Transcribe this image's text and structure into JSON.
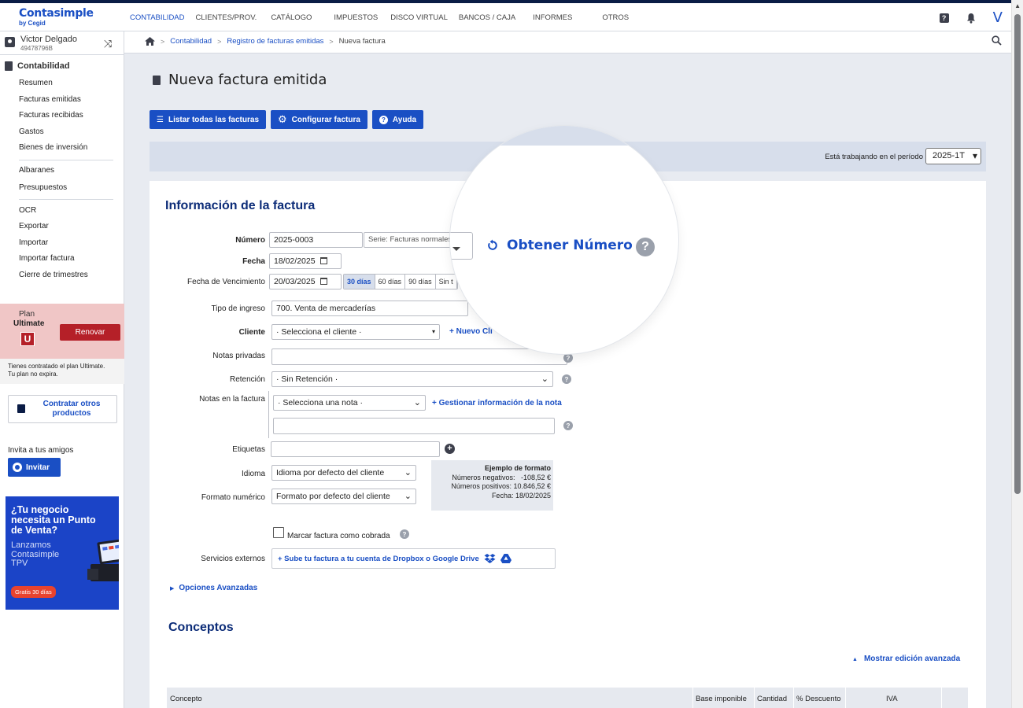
{
  "brand": {
    "name": "Contasimple",
    "sub": "by Cegid"
  },
  "topnav": [
    "CONTABILIDAD",
    "CLIENTES/PROV.",
    "CATÁLOGO",
    "IMPUESTOS",
    "DISCO VIRTUAL",
    "BANCOS / CAJA",
    "INFORMES",
    "OTROS"
  ],
  "topnav_active": "CONTABILIDAD",
  "top_icons": {
    "help": "?",
    "bell": "bell-icon",
    "user_initial": "V"
  },
  "user": {
    "name": "Victor Delgado",
    "id": "49478796B"
  },
  "sidebar": {
    "section": "Contabilidad",
    "group1": [
      "Resumen",
      "Facturas emitidas",
      "Facturas recibidas",
      "Gastos",
      "Bienes de inversión"
    ],
    "group2": [
      "Albaranes",
      "Presupuestos"
    ],
    "group3": [
      "OCR",
      "Exportar",
      "Importar",
      "Importar factura",
      "Cierre de trimestres"
    ]
  },
  "plan": {
    "label": "Plan",
    "name": "Ultimate",
    "badge": "U",
    "renew": "Renovar",
    "info_line1": "Tienes contratado el plan Ultimate.",
    "info_line2": "Tu plan no expira."
  },
  "contract": {
    "line1": "Contratar otros",
    "line2": "productos"
  },
  "invite": {
    "label": "Invita a tus amigos",
    "button": "Invitar"
  },
  "promo": {
    "title_lines": [
      "¿Tu negocio",
      "necesita un Punto",
      "de Venta?"
    ],
    "sub_lines": [
      "Lanzamos",
      "Contasimple",
      "TPV"
    ],
    "button": "Gratis 30 días"
  },
  "breadcrumb": {
    "items": [
      "Contabilidad",
      "Registro de facturas emitidas"
    ],
    "current": "Nueva factura"
  },
  "page": {
    "title": "Nueva factura emitida"
  },
  "buttons": {
    "list": "Listar todas las facturas",
    "config": "Configurar factura",
    "help": "Ayuda"
  },
  "period": {
    "label": "Está trabajando en el período",
    "value": "2025-1T"
  },
  "form": {
    "section_title": "Información de la factura",
    "numero_label": "Número",
    "numero_value": "2025-0003",
    "serie_value": "Serie: Facturas normales",
    "obtener": "Obtener Número",
    "fecha_label": "Fecha",
    "fecha_value": "18/02/2025",
    "venc_label": "Fecha de Vencimiento",
    "venc_value": "20/03/2025",
    "venc_options": [
      "30 días",
      "60 días",
      "90 días",
      "Sin t"
    ],
    "venc_active": "30 días",
    "tipo_label": "Tipo de ingreso",
    "tipo_value": "700. Venta de mercaderías",
    "cliente_label": "Cliente",
    "cliente_value": "· Selecciona el cliente ·",
    "nuevo_cliente": "+ Nuevo Cli",
    "notas_priv_label": "Notas privadas",
    "retencion_label": "Retención",
    "retencion_value": "· Sin Retención ·",
    "notas_fact_label": "Notas en la factura",
    "notas_fact_value": "· Selecciona una nota ·",
    "gestionar": "+ Gestionar información de la nota",
    "etiquetas_label": "Etiquetas",
    "idioma_label": "Idioma",
    "idioma_value": "Idioma por defecto del cliente",
    "formato_label": "Formato numérico",
    "formato_value": "Formato por defecto del cliente",
    "ejemplo": {
      "title": "Ejemplo de formato",
      "neg": "Números negativos:   -108,52 €",
      "pos": "Números positivos: 10.846,52 €",
      "fecha": "Fecha: 18/02/2025"
    },
    "cobrada": "Marcar factura como cobrada",
    "servicios_label": "Servicios externos",
    "servicios_btn": "+ Sube tu factura a tu cuenta de Dropbox o Google Drive",
    "avanzadas": "Opciones Avanzadas"
  },
  "conceptos": {
    "title": "Conceptos",
    "mostrar": "Mostrar edición avanzada",
    "columns": [
      "Concepto",
      "Base imponible",
      "Cantidad",
      "% Descuento",
      "IVA"
    ]
  }
}
